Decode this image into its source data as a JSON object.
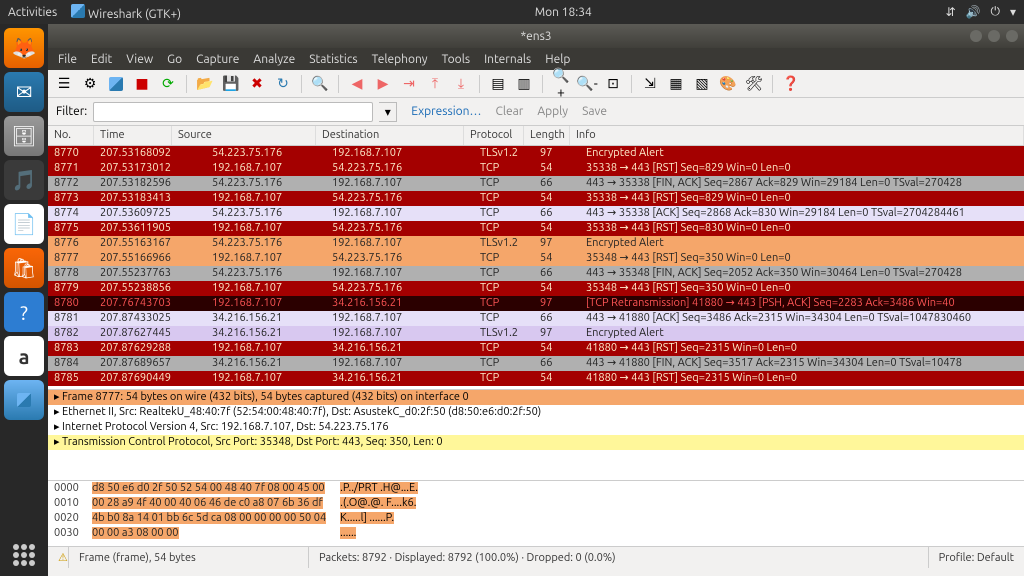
{
  "topbar": {
    "activities": "Activities",
    "app_label": "Wireshark (GTK+)",
    "clock": "Mon 18:34"
  },
  "window": {
    "title": "*ens3"
  },
  "menu": [
    "File",
    "Edit",
    "View",
    "Go",
    "Capture",
    "Analyze",
    "Statistics",
    "Telephony",
    "Tools",
    "Internals",
    "Help"
  ],
  "filterbar": {
    "label": "Filter:",
    "value": "",
    "expression": "Expression…",
    "clear": "Clear",
    "apply": "Apply",
    "save": "Save"
  },
  "columns": [
    "No.",
    "Time",
    "Source",
    "Destination",
    "Protocol",
    "Length",
    "Info"
  ],
  "packets": [
    {
      "cls": "r-red",
      "no": "8770",
      "time": "207.53168092",
      "src": "54.223.75.176",
      "dst": "192.168.7.107",
      "pro": "TLSv1.2",
      "len": "97",
      "info": "Encrypted Alert"
    },
    {
      "cls": "r-red",
      "no": "8771",
      "time": "207.53173012",
      "src": "192.168.7.107",
      "dst": "54.223.75.176",
      "pro": "TCP",
      "len": "54",
      "info": "35338 → 443 [RST] Seq=829 Win=0 Len=0"
    },
    {
      "cls": "r-gray",
      "no": "8772",
      "time": "207.53182596",
      "src": "54.223.75.176",
      "dst": "192.168.7.107",
      "pro": "TCP",
      "len": "66",
      "info": "443 → 35338 [FIN, ACK] Seq=2867 Ack=829 Win=29184 Len=0 TSval=270428"
    },
    {
      "cls": "r-red",
      "no": "8773",
      "time": "207.53183413",
      "src": "192.168.7.107",
      "dst": "54.223.75.176",
      "pro": "TCP",
      "len": "54",
      "info": "35338 → 443 [RST] Seq=829 Win=0 Len=0"
    },
    {
      "cls": "r-lav",
      "no": "8774",
      "time": "207.53609725",
      "src": "54.223.75.176",
      "dst": "192.168.7.107",
      "pro": "TCP",
      "len": "66",
      "info": "443 → 35338 [ACK] Seq=2868 Ack=830 Win=29184 Len=0 TSval=2704284461"
    },
    {
      "cls": "r-red",
      "no": "8775",
      "time": "207.53611905",
      "src": "192.168.7.107",
      "dst": "54.223.75.176",
      "pro": "TCP",
      "len": "54",
      "info": "35338 → 443 [RST] Seq=830 Win=0 Len=0"
    },
    {
      "cls": "r-orange",
      "no": "8776",
      "time": "207.55163167",
      "src": "54.223.75.176",
      "dst": "192.168.7.107",
      "pro": "TLSv1.2",
      "len": "97",
      "info": "Encrypted Alert"
    },
    {
      "cls": "r-orange",
      "no": "8777",
      "time": "207.55166966",
      "src": "192.168.7.107",
      "dst": "54.223.75.176",
      "pro": "TCP",
      "len": "54",
      "info": "35348 → 443 [RST] Seq=350 Win=0 Len=0"
    },
    {
      "cls": "r-gray",
      "no": "8778",
      "time": "207.55237763",
      "src": "54.223.75.176",
      "dst": "192.168.7.107",
      "pro": "TCP",
      "len": "66",
      "info": "443 → 35348 [FIN, ACK] Seq=2052 Ack=350 Win=30464 Len=0 TSval=270428"
    },
    {
      "cls": "r-red",
      "no": "8779",
      "time": "207.55238856",
      "src": "192.168.7.107",
      "dst": "54.223.75.176",
      "pro": "TCP",
      "len": "54",
      "info": "35348 → 443 [RST] Seq=350 Win=0 Len=0"
    },
    {
      "cls": "r-dark",
      "no": "8780",
      "time": "207.76743703",
      "src": "192.168.7.107",
      "dst": "34.216.156.21",
      "pro": "TCP",
      "len": "97",
      "info": "[TCP Retransmission] 41880 → 443 [PSH, ACK] Seq=2283 Ack=3486 Win=40"
    },
    {
      "cls": "r-lav",
      "no": "8781",
      "time": "207.87433025",
      "src": "34.216.156.21",
      "dst": "192.168.7.107",
      "pro": "TCP",
      "len": "66",
      "info": "443 → 41880 [ACK] Seq=3486 Ack=2315 Win=34304 Len=0 TSval=1047830460"
    },
    {
      "cls": "r-purple",
      "no": "8782",
      "time": "207.87627445",
      "src": "34.216.156.21",
      "dst": "192.168.7.107",
      "pro": "TLSv1.2",
      "len": "97",
      "info": "Encrypted Alert"
    },
    {
      "cls": "r-red",
      "no": "8783",
      "time": "207.87629288",
      "src": "192.168.7.107",
      "dst": "34.216.156.21",
      "pro": "TCP",
      "len": "54",
      "info": "41880 → 443 [RST] Seq=2315 Win=0 Len=0"
    },
    {
      "cls": "r-gray",
      "no": "8784",
      "time": "207.87689657",
      "src": "34.216.156.21",
      "dst": "192.168.7.107",
      "pro": "TCP",
      "len": "66",
      "info": "443 → 41880 [FIN, ACK] Seq=3517 Ack=2315 Win=34304 Len=0 TSval=10478"
    },
    {
      "cls": "r-red",
      "no": "8785",
      "time": "207.87690449",
      "src": "192.168.7.107",
      "dst": "34.216.156.21",
      "pro": "TCP",
      "len": "54",
      "info": "41880 → 443 [RST] Seq=2315 Win=0 Len=0"
    }
  ],
  "details": {
    "line0": "▸ Frame 8777: 54 bytes on wire (432 bits), 54 bytes captured (432 bits) on interface 0",
    "line1": "▸ Ethernet II, Src: RealtekU_48:40:7f (52:54:00:48:40:7f), Dst: AsustekC_d0:2f:50 (d8:50:e6:d0:2f:50)",
    "line2": "▸ Internet Protocol Version 4, Src: 192.168.7.107, Dst: 54.223.75.176",
    "line3": "▸ Transmission Control Protocol, Src Port: 35348, Dst Port: 443, Seq: 350, Len: 0"
  },
  "hex": {
    "offsets": [
      "0000",
      "0010",
      "0020",
      "0030"
    ],
    "bytes": [
      {
        "pre": "",
        "hl": "d8 50 e6 d0 2f 50 52 54  00 48 40 7f 08 00 45 00"
      },
      {
        "pre": "",
        "hl": "00 28 a9 4f 40 00 40 06  46 de c0 a8 07 6b 36 df"
      },
      {
        "pre": "",
        "hl": "4b b0 8a 14 01 bb 6c 5d  ca 08 00 00 00 00 50 04"
      },
      {
        "pre": "",
        "hl": "00 00 a3 08 00 00"
      }
    ],
    "ascii": [
      ".P../PRT .H@...E.",
      ".(.O@.@. F....k6.",
      "K.....l] ......P.",
      "......"
    ]
  },
  "statusbar": {
    "icon": "⚠",
    "frame": "Frame (frame), 54 bytes",
    "packets": "Packets: 8792 · Displayed: 8792 (100.0%) · Dropped: 0 (0.0%)",
    "profile": "Profile: Default"
  }
}
